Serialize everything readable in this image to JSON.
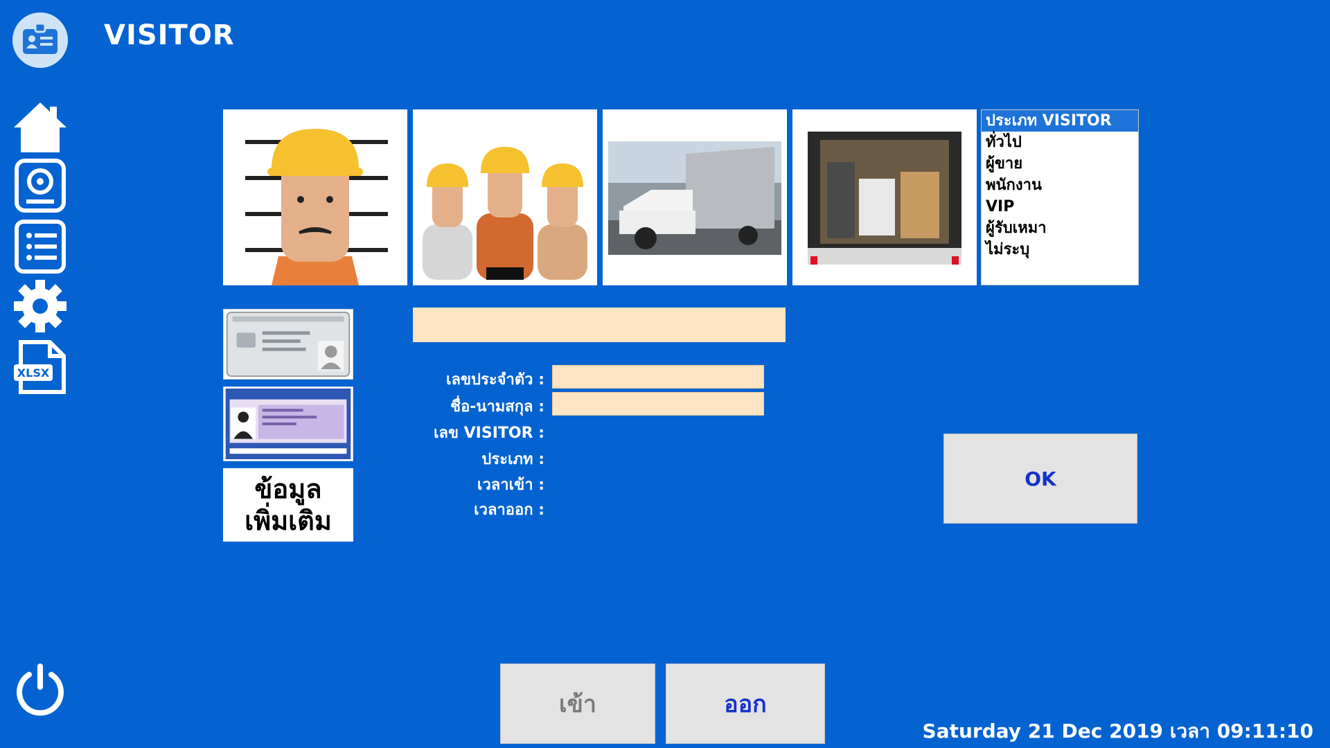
{
  "app": {
    "title": "VISITOR"
  },
  "sidebar": {
    "items": [
      {
        "name": "home",
        "icon": "home-icon"
      },
      {
        "name": "camera",
        "icon": "webcam-icon"
      },
      {
        "name": "list",
        "icon": "list-icon"
      },
      {
        "name": "settings",
        "icon": "gear-icon"
      },
      {
        "name": "export",
        "icon": "xlsx-file-icon",
        "label": "XLSX"
      }
    ],
    "power_icon": "power-icon"
  },
  "photos": [
    {
      "name": "visitor-face",
      "icon": "worker-mugshot-icon"
    },
    {
      "name": "group",
      "icon": "worker-group-icon"
    },
    {
      "name": "vehicle",
      "icon": "pickup-truck-photo"
    },
    {
      "name": "cargo",
      "icon": "truck-cargo-photo"
    }
  ],
  "visitor_types": {
    "header": "ประเภท VISITOR",
    "options": [
      "ทั่วไป",
      "ผู้ขาย",
      "พนักงาน",
      "VIP",
      "ผู้รับเหมา",
      "ไม่ระบุ"
    ]
  },
  "cards": {
    "id_card_icon": "thai-id-card-icon",
    "driver_license_icon": "driving-license-icon",
    "more_info_label": "ข้อมูล\nเพิ่มเติม"
  },
  "form": {
    "banner_value": "",
    "id_label": "เลขประจำตัว :",
    "id_value": "",
    "name_label": "ชื่อ-นามสกุล :",
    "name_value": "",
    "visitor_no_label": "เลข VISITOR :",
    "type_label": "ประเภท :",
    "time_in_label": "เวลาเข้า :",
    "time_out_label": "เวลาออก :"
  },
  "buttons": {
    "ok": "OK",
    "enter": "เข้า",
    "exit": "ออก"
  },
  "status": {
    "datetime": "Saturday 21 Dec 2019 เวลา 09:11:10"
  },
  "colors": {
    "background": "#0563D1",
    "input": "#FDE4C3",
    "button": "#E3E3E3",
    "accent_text": "#1533C9",
    "selected": "#1E73D8"
  }
}
